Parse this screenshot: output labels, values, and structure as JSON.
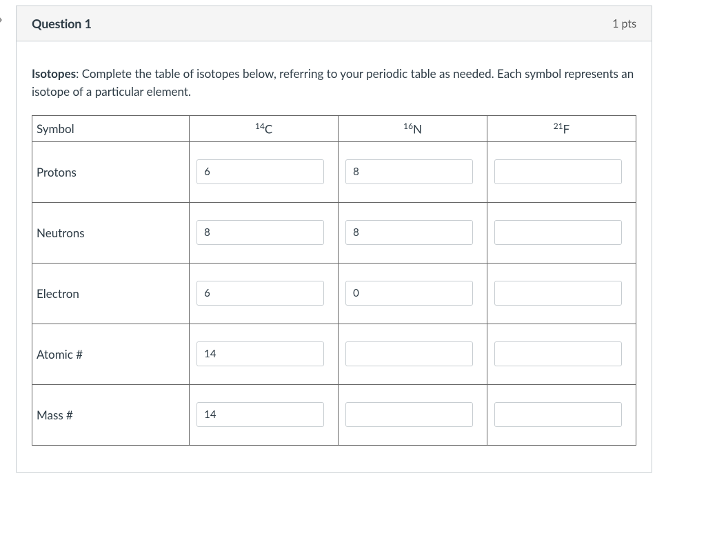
{
  "header": {
    "title": "Question 1",
    "points": "1 pts"
  },
  "instructions": {
    "lead": "Isotopes",
    "text": ":  Complete the table of isotopes below, referring to your periodic table as needed.  Each symbol represents an isotope of a particular element."
  },
  "table": {
    "symbol_label": "Symbol",
    "columns": [
      {
        "mass": "14",
        "letter": "C"
      },
      {
        "mass": "16",
        "letter": "N"
      },
      {
        "mass": "21",
        "letter": "F"
      }
    ],
    "rows": [
      {
        "label": "Protons",
        "values": [
          "6",
          "8",
          ""
        ]
      },
      {
        "label": "Neutrons",
        "values": [
          "8",
          "8",
          ""
        ]
      },
      {
        "label": "Electron",
        "values": [
          "6",
          "0",
          ""
        ]
      },
      {
        "label": "Atomic #",
        "values": [
          "14",
          "",
          ""
        ]
      },
      {
        "label": "Mass #",
        "values": [
          "14",
          "",
          ""
        ]
      }
    ]
  }
}
